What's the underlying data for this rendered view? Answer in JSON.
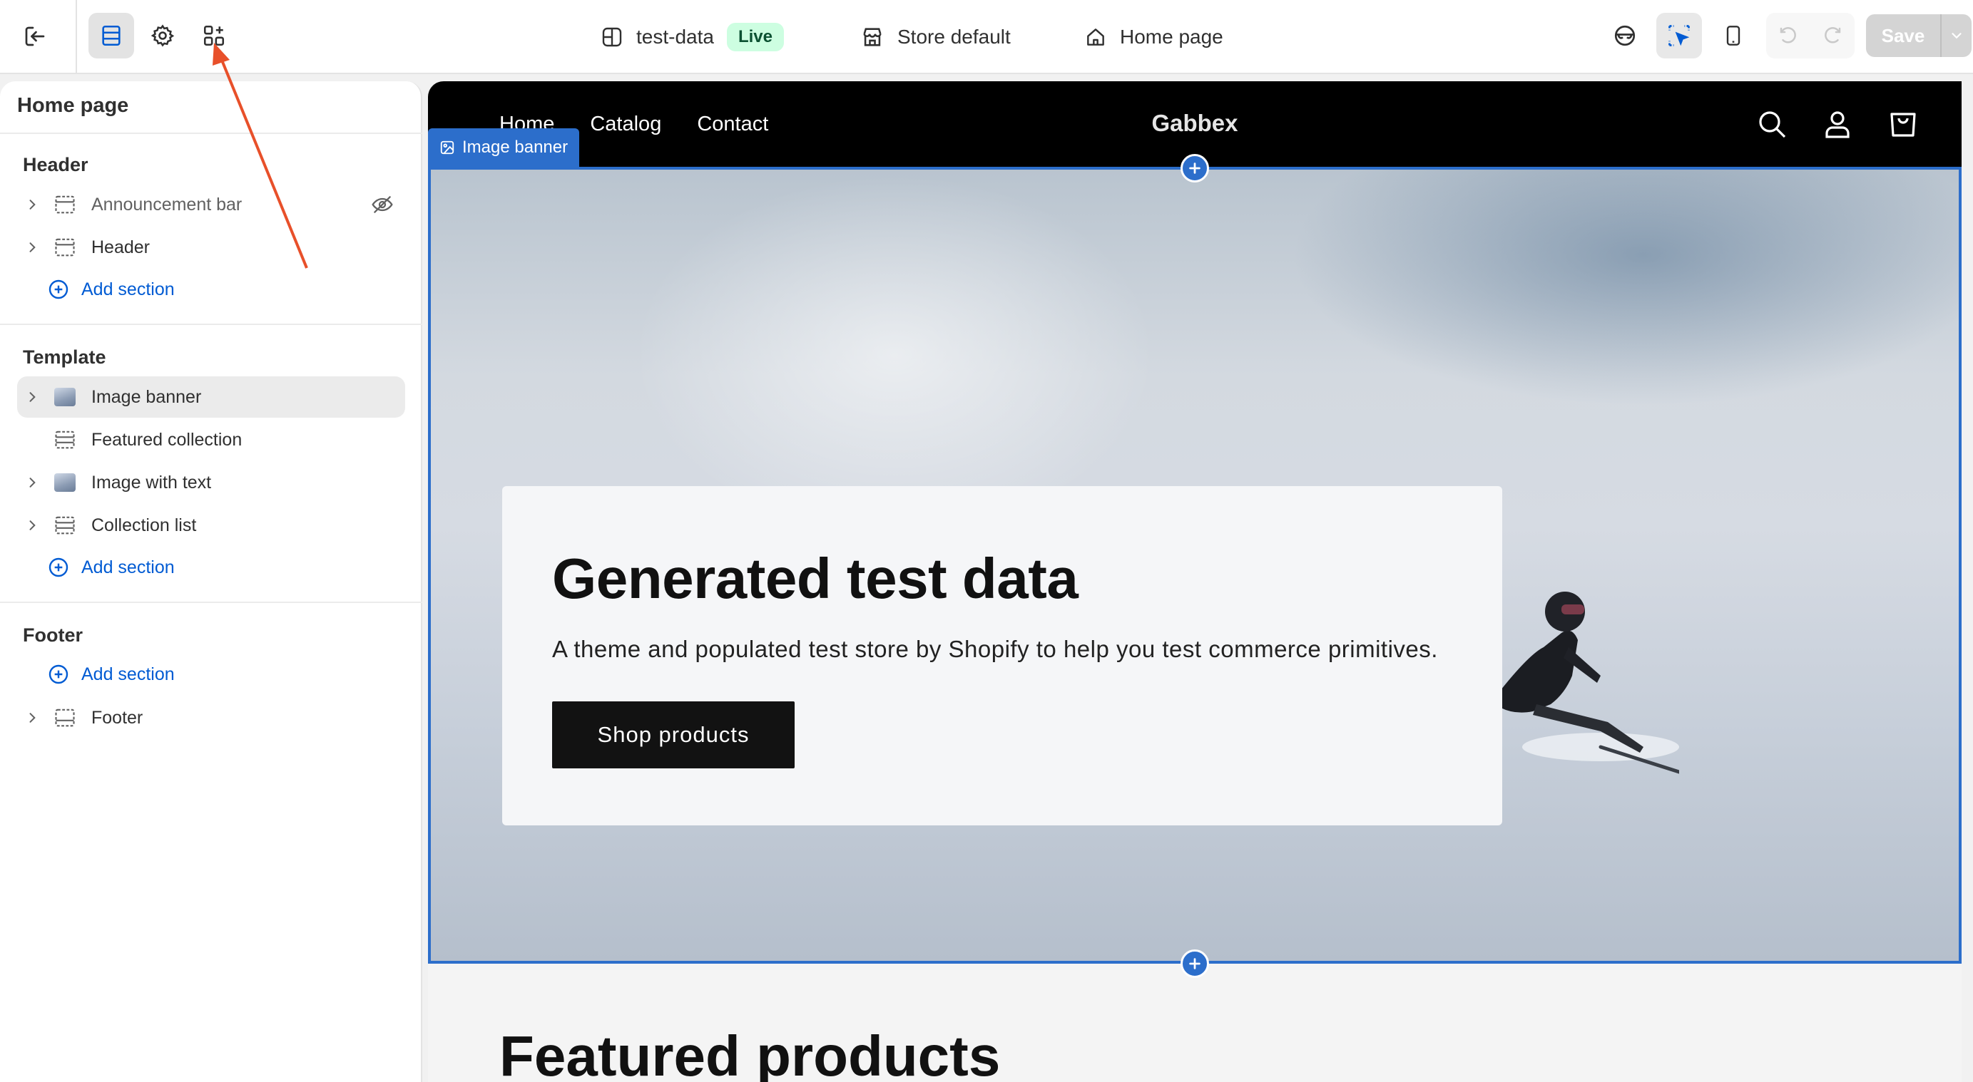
{
  "topbar": {
    "theme_name": "test-data",
    "theme_status": "Live",
    "market": "Store default",
    "template": "Home page",
    "save_label": "Save"
  },
  "sidebar": {
    "title": "Home page",
    "header_group": {
      "title": "Header",
      "items": [
        {
          "label": "Announcement bar",
          "hidden": true
        },
        {
          "label": "Header"
        }
      ],
      "add_label": "Add section"
    },
    "template_group": {
      "title": "Template",
      "items": [
        {
          "label": "Image banner",
          "selected": true
        },
        {
          "label": "Featured collection"
        },
        {
          "label": "Image with text"
        },
        {
          "label": "Collection list"
        }
      ],
      "add_label": "Add section"
    },
    "footer_group": {
      "title": "Footer",
      "add_label": "Add section",
      "items": [
        {
          "label": "Footer"
        }
      ]
    }
  },
  "preview": {
    "nav": {
      "links": [
        "Home",
        "Catalog",
        "Contact"
      ],
      "brand": "Gabbex"
    },
    "section_tag": "Image banner",
    "banner": {
      "heading": "Generated test data",
      "subheading": "A theme and populated test store by Shopify to help you test commerce primitives.",
      "button": "Shop products"
    },
    "next_heading": "Featured products"
  },
  "colors": {
    "accent": "#2c6ecb",
    "link": "#005bd3",
    "live_bg": "#cdfee1",
    "annotation": "#e8502a"
  }
}
